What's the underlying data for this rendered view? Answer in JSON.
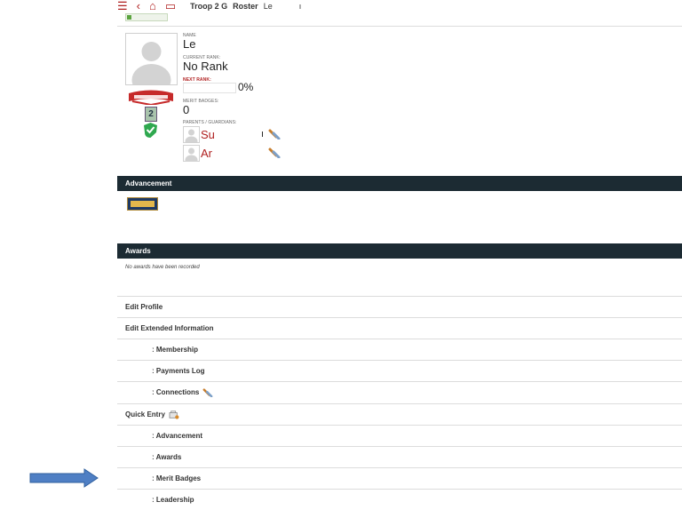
{
  "header": {
    "menu_icon": "hamburger-icon",
    "back_icon": "chevron-left-icon",
    "home_icon": "home-icon",
    "calendar_icon": "calendar-icon",
    "troop": "Troop 2 G",
    "roster": "Roster",
    "name_fragment": "Le",
    "trailing": "ı"
  },
  "profile": {
    "name_label": "NAME",
    "name": "Le",
    "current_rank_label": "CURRENT RANK:",
    "current_rank": "No Rank",
    "next_rank_label": "NEXT RANK:",
    "next_rank_progress": 0,
    "next_rank_percent": "0%",
    "merit_badges_label": "MERIT BADGES:",
    "merit_badges": "0",
    "rank_number": "2",
    "guardians_label": "PARENTS / GUARDIANS:",
    "guardians": [
      {
        "name": "Su",
        "suffix": "ı",
        "icon": "connection-icon"
      },
      {
        "name": "Ar",
        "suffix": "",
        "icon": "connection-icon"
      }
    ]
  },
  "sections": {
    "advancement": "Advancement",
    "awards": "Awards",
    "awards_empty": "No awards have been recorded"
  },
  "menu": {
    "edit_profile": "Edit Profile",
    "edit_extended": "Edit Extended Information",
    "membership": "ː Membership",
    "payments_log": "ː Payments Log",
    "connections": "ː Connections",
    "quick_entry": "Quick Entry",
    "qe_advancement": "ː Advancement",
    "qe_awards": "ː Awards",
    "qe_merit_badges": "ː Merit Badges",
    "qe_leadership": "ː Leadership"
  },
  "colors": {
    "accent_red": "#b02020",
    "section_band": "#1c2b33",
    "success_green": "#5ba43f",
    "arrow_blue": "#4f7fc4"
  }
}
